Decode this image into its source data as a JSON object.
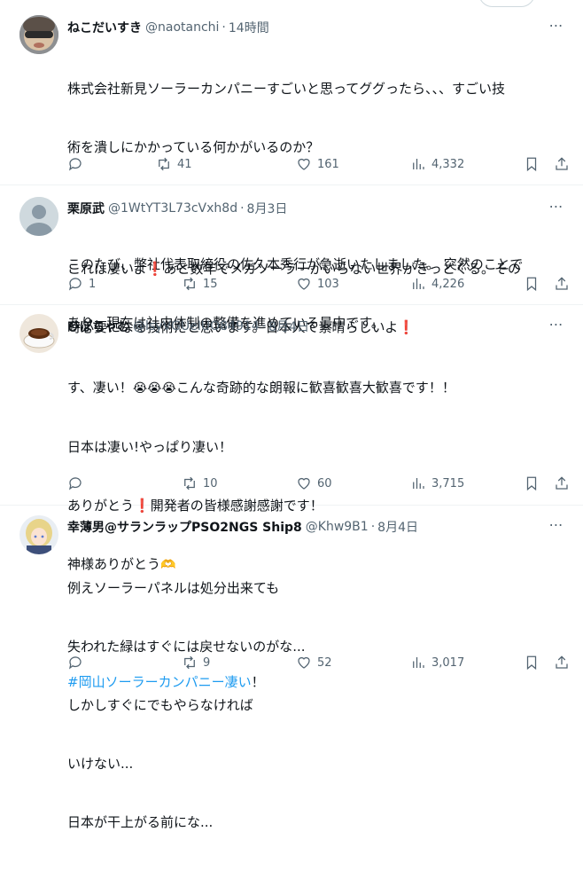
{
  "tweets": [
    {
      "name": "ねこだいすき",
      "handle": "@naotanchi",
      "time": "14時間",
      "line1": "株式会社新見ソーラーカンパニーすごいと思ってググったら、、、すごい技",
      "line2": "術を潰しにかかっている何かがいるのか？",
      "line3": "このたび、弊社代表取締役の佐久本秀行が急逝いたしました。 突然のことで",
      "line4": "あり、現在は社内体制の整備を進めている最中です。",
      "replies": "",
      "retweets": "41",
      "likes": "161",
      "views": "4,332"
    },
    {
      "name": "栗原武",
      "handle": "@1WtYT3L73cVxh8d",
      "time": "8月3日",
      "line1a": "これは凄いよ",
      "line1b": "あと数年でメガソーラーがいらない世界がきっとくる。その",
      "line2": "時必要になる技術だと思います。日本人て素晴らしいよ",
      "replies": "1",
      "retweets": "15",
      "likes": "103",
      "views": "4,226"
    },
    {
      "name": "ひぽちゃむ",
      "handle": "@lsyVGUeIUO84914",
      "time": "8月4日",
      "line1a": "す、凄い！",
      "line1b": "こんな奇跡的な朗報に歓喜歓喜大歓喜です！！",
      "line2": "日本は凄い!やっぱり凄い！",
      "line3a": "ありがとう",
      "line3b": "開発者の皆様感謝感謝です！",
      "line4": "神様ありがとう",
      "hashtag": "#岡山ソーラーカンパニー凄い",
      "hashtag_suffix": "！",
      "replies": "",
      "retweets": "10",
      "likes": "60",
      "views": "3,715"
    },
    {
      "name": "幸薄男@サランラップPSO2NGS Ship8",
      "handle": "@Khw9B1",
      "time": "8月4日",
      "line1": "例えソーラーパネルは処分出来ても",
      "line2": "失われた緑はすぐには戻せないのがな...",
      "line3": "しかしすぐにでもやらなければ",
      "line4": "いけない...",
      "line5": "日本が干上がる前にな...",
      "replies": "",
      "retweets": "9",
      "likes": "52",
      "views": "3,017"
    }
  ],
  "separator": "·",
  "more_icon": "⋯",
  "emoji": {
    "exclamation": "❗",
    "crying": "😭",
    "heart_hands": "🫶"
  },
  "colors": {
    "text": "#0f1419",
    "secondary": "#536471",
    "link": "#1d9bf0",
    "border": "#eff3f4"
  }
}
